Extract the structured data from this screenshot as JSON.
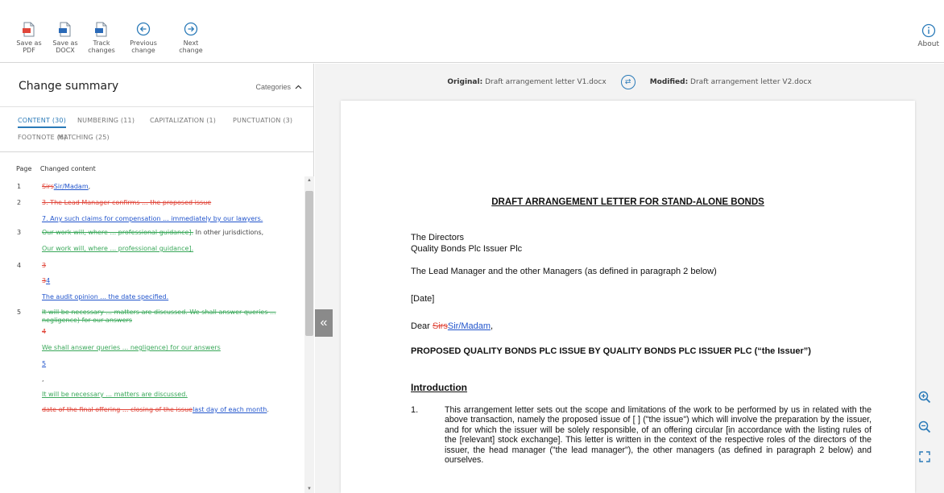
{
  "toolbar": {
    "save_pdf": "Save as\nPDF",
    "save_docx": "Save as\nDOCX",
    "track_changes": "Track\nchanges",
    "previous_change": "Previous\nchange",
    "next_change": "Next\nchange",
    "about": "About"
  },
  "summary": {
    "title": "Change summary",
    "categories": "Categories",
    "tabs": [
      "CONTENT (30)",
      "NUMBERING (11)",
      "CAPITALIZATION (1)",
      "PUNCTUATION (3)",
      "FOOTNOTE (6)",
      "MATCHING (25)"
    ],
    "col_page": "Page",
    "col_content": "Changed content",
    "rows": [
      {
        "page": "1",
        "parts": [
          {
            "t": "Sirs",
            "s": "del"
          },
          {
            "t": "Sir/Madam",
            "s": "ins"
          },
          {
            "t": ",",
            "s": "plain"
          }
        ]
      },
      {
        "page": "2",
        "parts": [
          {
            "t": "3. The Lead Manager confirms ... the proposed issue",
            "s": "del"
          }
        ]
      },
      {
        "page": "",
        "parts": [
          {
            "t": "7. Any such claims for compensation ... immediately by our lawyers.",
            "s": "ins"
          }
        ]
      },
      {
        "page": "3",
        "parts": [
          {
            "t": "Our work will, where ... professional guidance].",
            "s": "movdel"
          },
          {
            "t": " In other jurisdictions,",
            "s": "plain"
          }
        ]
      },
      {
        "page": "",
        "parts": [
          {
            "t": "Our work will, where ... professional guidance].",
            "s": "mov"
          }
        ]
      },
      {
        "page": "4",
        "parts": [
          {
            "t": "3",
            "s": "del"
          }
        ]
      },
      {
        "page": "",
        "parts": [
          {
            "t": "3",
            "s": "del"
          },
          {
            "t": "4",
            "s": "ins"
          }
        ]
      },
      {
        "page": "",
        "parts": [
          {
            "t": "The audit opinion ... the date specified.",
            "s": "ins"
          }
        ]
      },
      {
        "page": "5",
        "parts": [
          {
            "t": "It will be necessary ... matters are discussed. We shall answer queries ... negligence) for our answers",
            "s": "movdel"
          }
        ]
      },
      {
        "page": "",
        "parts": [
          {
            "t": "4",
            "s": "del"
          }
        ]
      },
      {
        "page": "",
        "parts": [
          {
            "t": "We shall answer queries ... negligence) for our answers",
            "s": "mov"
          }
        ]
      },
      {
        "page": "",
        "parts": [
          {
            "t": "5",
            "s": "ins"
          }
        ]
      },
      {
        "page": "",
        "parts": [
          {
            "t": ",",
            "s": "plain"
          }
        ]
      },
      {
        "page": "",
        "parts": [
          {
            "t": "It will be necessary ... matters are discussed.",
            "s": "mov"
          }
        ]
      },
      {
        "page": "",
        "parts": [
          {
            "t": "date of the final offering ... closing of the issue",
            "s": "del"
          },
          {
            "t": "last day of each month",
            "s": "ins"
          },
          {
            "t": ".",
            "s": "plain"
          }
        ]
      }
    ]
  },
  "files": {
    "original_label": "Original:",
    "original_name": "Draft arrangement letter V1.docx",
    "modified_label": "Modified:",
    "modified_name": "Draft arrangement letter V2.docx"
  },
  "document": {
    "title": "DRAFT ARRANGEMENT LETTER FOR STAND-ALONE BONDS",
    "directors": "The Directors",
    "company": "Quality Bonds Plc Issuer Plc",
    "managers": "The Lead Manager and the other Managers (as defined in paragraph 2 below)",
    "date": "[Date]",
    "dear": "Dear ",
    "dear_del": "Sirs",
    "dear_ins": "Sir/Madam",
    "dear_end": ",",
    "heading": "PROPOSED QUALITY BONDS PLC ISSUE BY QUALITY BONDS PLC ISSUER PLC (“the Issuer”)",
    "intro": "Introduction",
    "para_num": "1.",
    "para_text": "This arrangement letter sets out the scope and limitations of the work to be performed by us in related with the above transaction, namely the proposed issue of [ ] (\"the issue\") which will involve the preparation by the issuer, and for which the issuer will be solely responsible, of an offering circular [in accordance with the listing rules of the [relevant] stock exchange]. This letter is written in the context of the respective roles of the directors of the issuer, the head manager (\"the lead manager\"), the other managers (as defined in paragraph 2 below) and ourselves."
  },
  "colors": {
    "accent": "#2a7ab8",
    "deleted": "#e0463a",
    "inserted": "#2255cc",
    "moved": "#3aa85a"
  }
}
